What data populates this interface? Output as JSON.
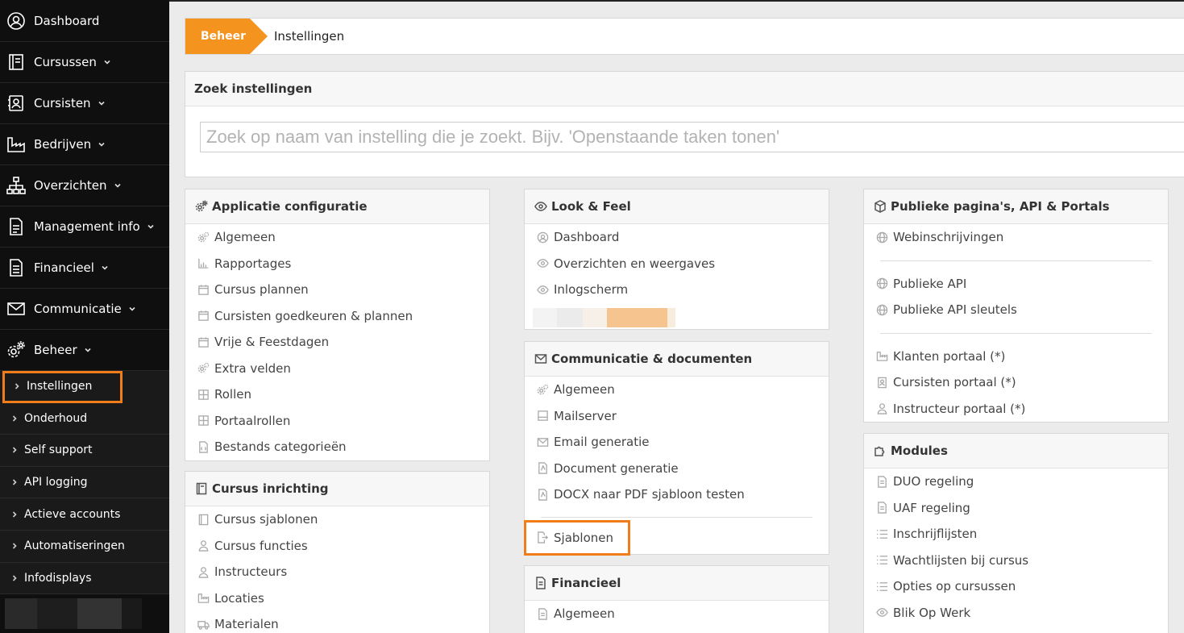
{
  "sidebar": {
    "items": [
      {
        "label": "Dashboard",
        "icon": "user-circle-icon",
        "caret": false
      },
      {
        "label": "Cursussen",
        "icon": "book-icon",
        "caret": true
      },
      {
        "label": "Cursisten",
        "icon": "contact-card-icon",
        "caret": true
      },
      {
        "label": "Bedrijven",
        "icon": "factory-icon",
        "caret": true
      },
      {
        "label": "Overzichten",
        "icon": "sitemap-icon",
        "caret": true
      },
      {
        "label": "Management info",
        "icon": "document-chart-icon",
        "caret": true
      },
      {
        "label": "Financieel",
        "icon": "document-icon",
        "caret": true
      },
      {
        "label": "Communicatie",
        "icon": "envelope-icon",
        "caret": true
      },
      {
        "label": "Beheer",
        "icon": "gears-icon",
        "caret": true
      }
    ],
    "sub_items": [
      {
        "label": "Instellingen",
        "active": true
      },
      {
        "label": "Onderhoud"
      },
      {
        "label": "Self support"
      },
      {
        "label": "API logging"
      },
      {
        "label": "Actieve accounts"
      },
      {
        "label": "Automatiseringen"
      },
      {
        "label": "Infodisplays"
      }
    ]
  },
  "breadcrumb": {
    "home": "Beheer",
    "current": "Instellingen"
  },
  "search": {
    "title": "Zoek instellingen",
    "placeholder": "Zoek op naam van instelling die je zoekt. Bijv. 'Openstaande taken tonen'"
  },
  "panels": {
    "applicatie": {
      "title": "Applicatie configuratie",
      "items": [
        "Algemeen",
        "Rapportages",
        "Cursus plannen",
        "Cursisten goedkeuren & plannen",
        "Vrije & Feestdagen",
        "Extra velden",
        "Rollen",
        "Portaalrollen",
        "Bestands categorieën"
      ]
    },
    "cursus": {
      "title": "Cursus inrichting",
      "items": [
        "Cursus sjablonen",
        "Cursus functies",
        "Instructeurs",
        "Locaties",
        "Materialen"
      ]
    },
    "look": {
      "title": "Look & Feel",
      "items": [
        "Dashboard",
        "Overzichten en weergaves",
        "Inlogscherm"
      ]
    },
    "communicatie": {
      "title": "Communicatie & documenten",
      "items": [
        "Algemeen",
        "Mailserver",
        "Email generatie",
        "Document generatie",
        "DOCX naar PDF sjabloon testen"
      ],
      "highlighted": "Sjablonen"
    },
    "financieel": {
      "title": "Financieel",
      "items": [
        "Algemeen"
      ]
    },
    "publiek": {
      "title": "Publieke pagina's, API & Portals",
      "group1": [
        "Webinschrijvingen"
      ],
      "group2": [
        "Publieke API",
        "Publieke API sleutels"
      ],
      "group3": [
        "Klanten portaal (*)",
        "Cursisten portaal (*)",
        "Instructeur portaal (*)"
      ]
    },
    "modules": {
      "title": "Modules",
      "items": [
        "DUO regeling",
        "UAF regeling",
        "Inschrijflijsten",
        "Wachtlijsten bij cursus",
        "Opties op cursussen",
        "Blik Op Werk"
      ]
    }
  },
  "colors": {
    "accent": "#f5931f",
    "highlight_border": "#f07c1a",
    "sidebar_bg": "#0f0f0f"
  }
}
